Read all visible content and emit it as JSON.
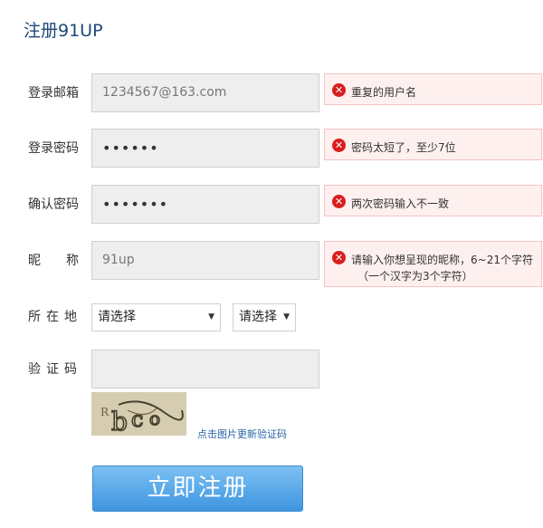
{
  "page": {
    "title": "注册91UP"
  },
  "form": {
    "email": {
      "label": "登录邮箱",
      "value": "1234567@163.com",
      "error": "重复的用户名"
    },
    "password": {
      "label": "登录密码",
      "value": "••••••",
      "error": "密码太短了，至少7位"
    },
    "confirm": {
      "label": "确认密码",
      "value": "•••••••",
      "error": "两次密码输入不一致"
    },
    "nickname": {
      "label_left": "昵",
      "label_right": "称",
      "value": "91up",
      "error_line1": "请输入你想呈现的昵称，6~21个字符",
      "error_line2": "（一个汉字为3个字符）"
    },
    "location": {
      "label": "所在地",
      "select1": "请选择",
      "select2": "请选择"
    },
    "captcha": {
      "label": "验证码",
      "value": "",
      "image_text": "Rbco",
      "refresh_link": "点击图片更新验证码"
    },
    "submit_label": "立即注册"
  },
  "icons": {
    "error": "error-x-icon",
    "dropdown": "caret-down-icon"
  },
  "colors": {
    "title": "#1b4a7a",
    "error_icon": "#d91e1e",
    "error_bg": "#fff0f0",
    "button": "#4a9fe6",
    "link": "#2a64a4"
  }
}
